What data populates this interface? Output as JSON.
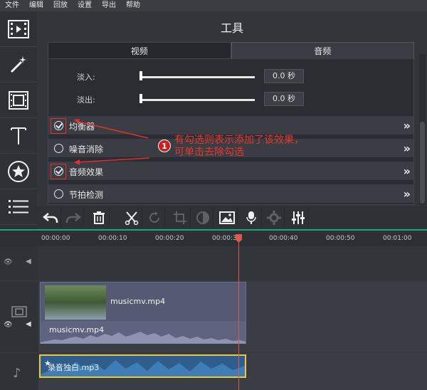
{
  "menu": [
    "文件",
    "编辑",
    "回放",
    "设置",
    "导出",
    "帮助"
  ],
  "sidebar_icons": [
    "film-icon",
    "magic-wand-icon",
    "filmstrip-icon",
    "text-icon",
    "star-sticker-icon",
    "list-icon"
  ],
  "tools": {
    "title": "工具",
    "tabs": [
      {
        "label": "视频"
      },
      {
        "label": "音频"
      }
    ],
    "active_tab": "音频",
    "fade_in": {
      "label": "淡入:",
      "value": "0.0 秒"
    },
    "fade_out": {
      "label": "淡出:",
      "value": "0.0 秒"
    },
    "effects": [
      {
        "label": "均衡器",
        "checked": true
      },
      {
        "label": "噪音消除",
        "checked": false
      },
      {
        "label": "音频效果",
        "checked": true
      },
      {
        "label": "节拍检测",
        "checked": false
      }
    ],
    "expand_glyph": "»"
  },
  "annotation": {
    "number": "1",
    "line1": "有勾选则表示添加了该效果，",
    "line2": "可单击去除勾选"
  },
  "toolbar_icons": [
    "undo-icon",
    "redo-icon",
    "delete-icon",
    "cut-icon",
    "rotate-icon",
    "crop-icon",
    "color-adjust-icon",
    "image-icon",
    "microphone-icon",
    "settings-icon",
    "equalizer-icon"
  ],
  "timeline": {
    "ticks": [
      "00:00:00",
      "00:00:10",
      "00:00:20",
      "00:00:30",
      "00:00:40",
      "00:00:50",
      "00:01:00"
    ],
    "video_clip_name": "musicmv.mp4",
    "video_audio_name": "musicmv.mp4",
    "audio_clip_name": "录音独白.mp3"
  },
  "colors": {
    "accent": "#23a37c",
    "annotation": "#e03030",
    "playhead": "#e0584a"
  }
}
